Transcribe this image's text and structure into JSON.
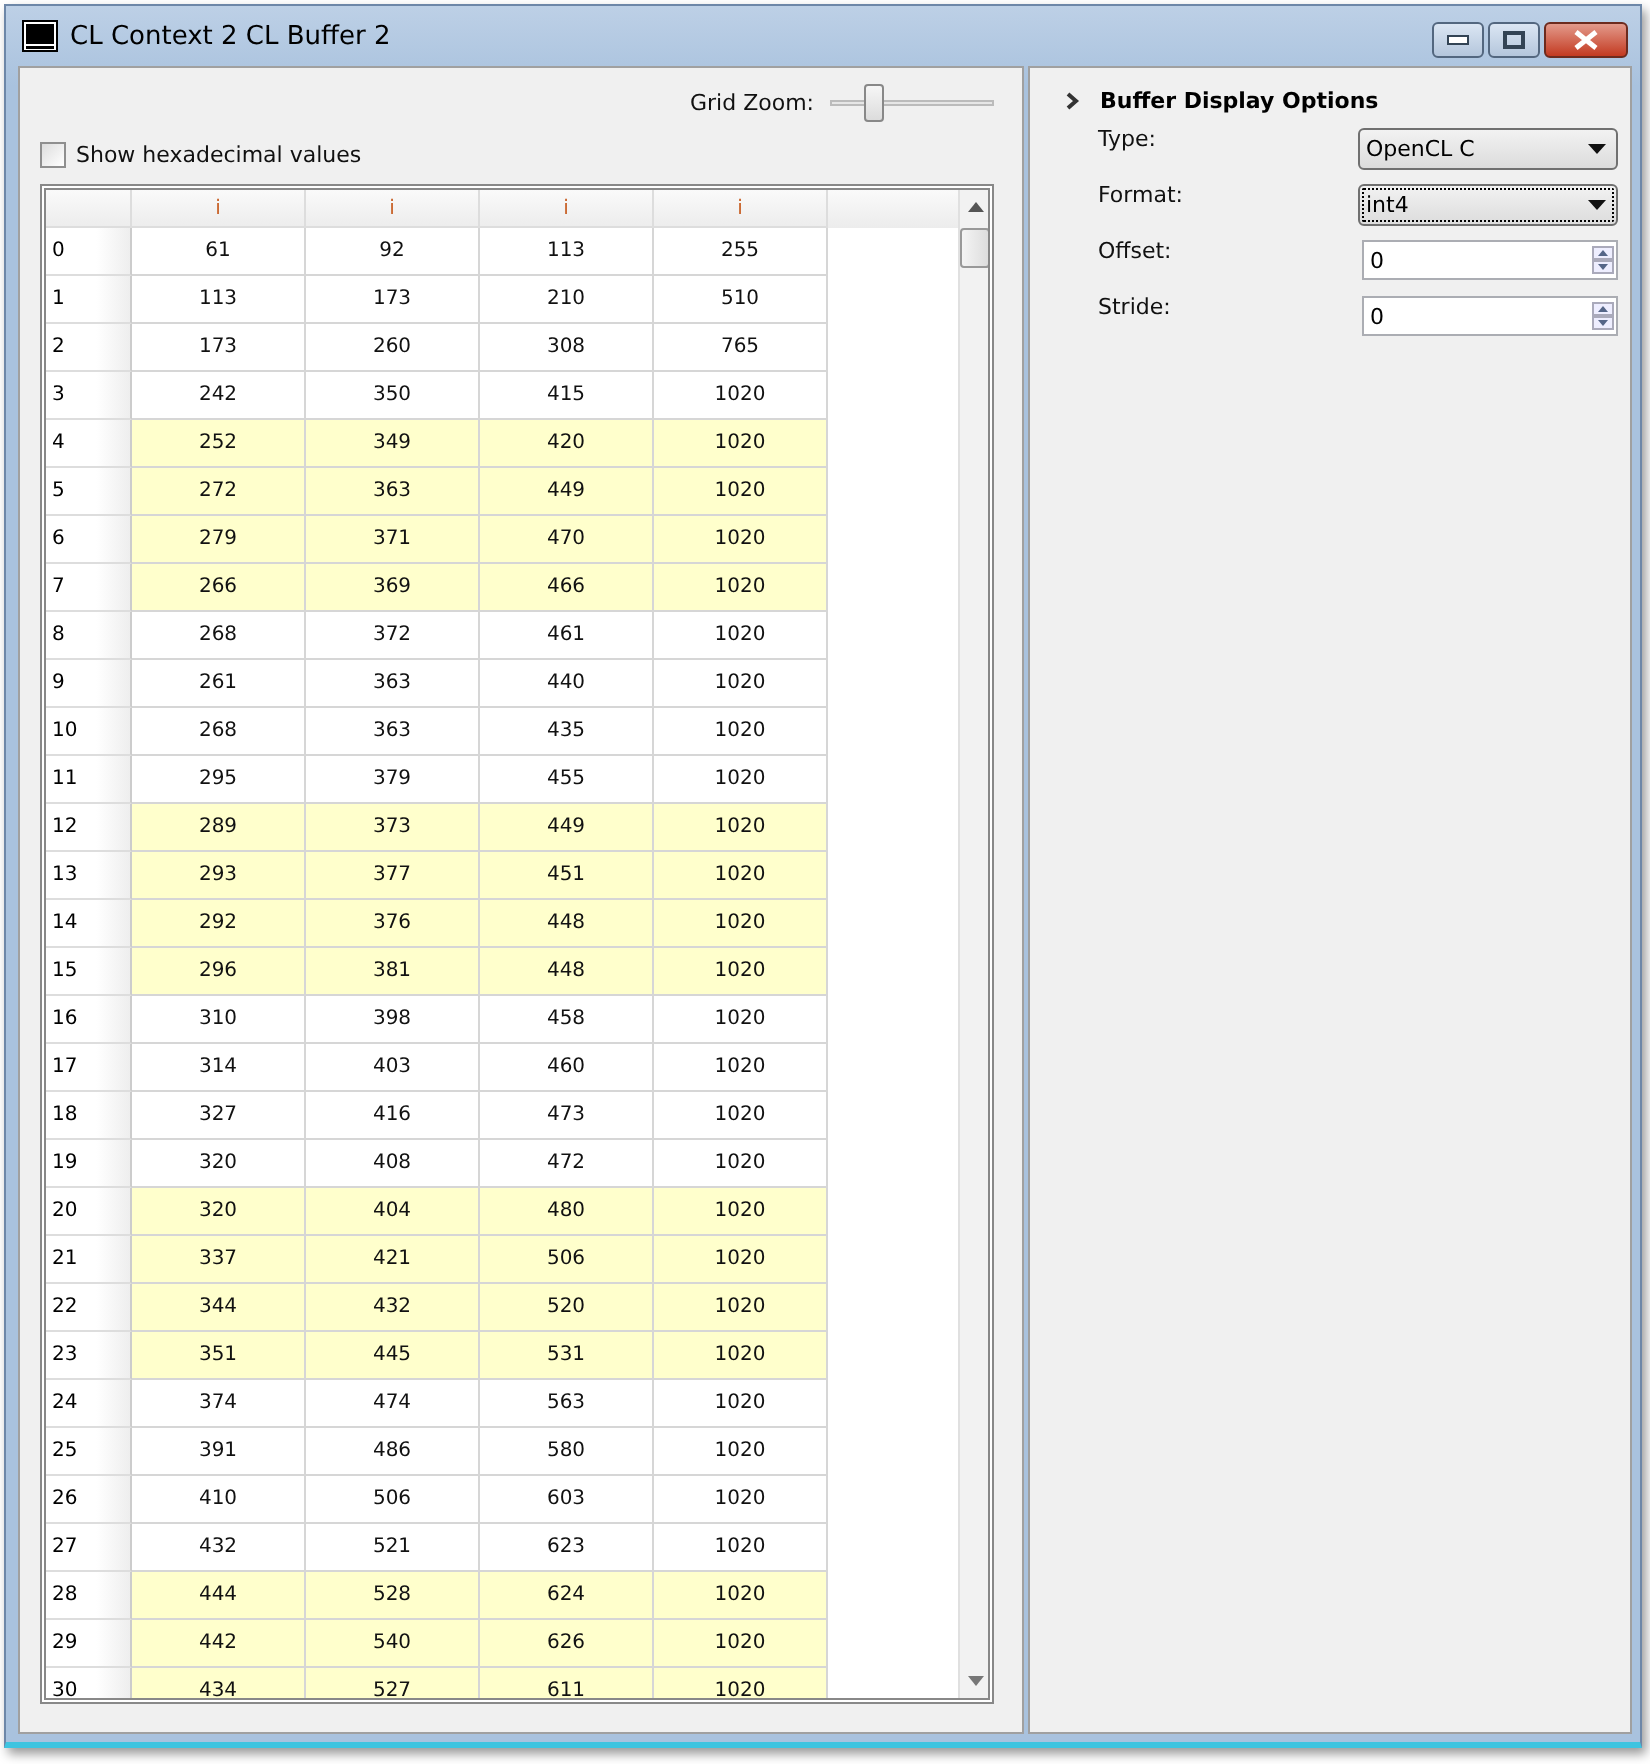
{
  "window": {
    "title": "CL Context 2 CL Buffer 2"
  },
  "grid_zoom": {
    "label": "Grid Zoom:",
    "level": 0.27
  },
  "show_hex": {
    "label": "Show hexadecimal values",
    "checked": false
  },
  "table": {
    "columns": [
      "i",
      "i",
      "i",
      "i"
    ],
    "rows": [
      {
        "index": "0",
        "values": [
          "61",
          "92",
          "113",
          "255"
        ],
        "highlighted": false
      },
      {
        "index": "1",
        "values": [
          "113",
          "173",
          "210",
          "510"
        ],
        "highlighted": false
      },
      {
        "index": "2",
        "values": [
          "173",
          "260",
          "308",
          "765"
        ],
        "highlighted": false
      },
      {
        "index": "3",
        "values": [
          "242",
          "350",
          "415",
          "1020"
        ],
        "highlighted": false
      },
      {
        "index": "4",
        "values": [
          "252",
          "349",
          "420",
          "1020"
        ],
        "highlighted": true
      },
      {
        "index": "5",
        "values": [
          "272",
          "363",
          "449",
          "1020"
        ],
        "highlighted": true
      },
      {
        "index": "6",
        "values": [
          "279",
          "371",
          "470",
          "1020"
        ],
        "highlighted": true
      },
      {
        "index": "7",
        "values": [
          "266",
          "369",
          "466",
          "1020"
        ],
        "highlighted": true
      },
      {
        "index": "8",
        "values": [
          "268",
          "372",
          "461",
          "1020"
        ],
        "highlighted": false
      },
      {
        "index": "9",
        "values": [
          "261",
          "363",
          "440",
          "1020"
        ],
        "highlighted": false
      },
      {
        "index": "10",
        "values": [
          "268",
          "363",
          "435",
          "1020"
        ],
        "highlighted": false
      },
      {
        "index": "11",
        "values": [
          "295",
          "379",
          "455",
          "1020"
        ],
        "highlighted": false
      },
      {
        "index": "12",
        "values": [
          "289",
          "373",
          "449",
          "1020"
        ],
        "highlighted": true
      },
      {
        "index": "13",
        "values": [
          "293",
          "377",
          "451",
          "1020"
        ],
        "highlighted": true
      },
      {
        "index": "14",
        "values": [
          "292",
          "376",
          "448",
          "1020"
        ],
        "highlighted": true
      },
      {
        "index": "15",
        "values": [
          "296",
          "381",
          "448",
          "1020"
        ],
        "highlighted": true
      },
      {
        "index": "16",
        "values": [
          "310",
          "398",
          "458",
          "1020"
        ],
        "highlighted": false
      },
      {
        "index": "17",
        "values": [
          "314",
          "403",
          "460",
          "1020"
        ],
        "highlighted": false
      },
      {
        "index": "18",
        "values": [
          "327",
          "416",
          "473",
          "1020"
        ],
        "highlighted": false
      },
      {
        "index": "19",
        "values": [
          "320",
          "408",
          "472",
          "1020"
        ],
        "highlighted": false
      },
      {
        "index": "20",
        "values": [
          "320",
          "404",
          "480",
          "1020"
        ],
        "highlighted": true
      },
      {
        "index": "21",
        "values": [
          "337",
          "421",
          "506",
          "1020"
        ],
        "highlighted": true
      },
      {
        "index": "22",
        "values": [
          "344",
          "432",
          "520",
          "1020"
        ],
        "highlighted": true
      },
      {
        "index": "23",
        "values": [
          "351",
          "445",
          "531",
          "1020"
        ],
        "highlighted": true
      },
      {
        "index": "24",
        "values": [
          "374",
          "474",
          "563",
          "1020"
        ],
        "highlighted": false
      },
      {
        "index": "25",
        "values": [
          "391",
          "486",
          "580",
          "1020"
        ],
        "highlighted": false
      },
      {
        "index": "26",
        "values": [
          "410",
          "506",
          "603",
          "1020"
        ],
        "highlighted": false
      },
      {
        "index": "27",
        "values": [
          "432",
          "521",
          "623",
          "1020"
        ],
        "highlighted": false
      },
      {
        "index": "28",
        "values": [
          "444",
          "528",
          "624",
          "1020"
        ],
        "highlighted": true
      },
      {
        "index": "29",
        "values": [
          "442",
          "540",
          "626",
          "1020"
        ],
        "highlighted": true
      },
      {
        "index": "30",
        "values": [
          "434",
          "527",
          "611",
          "1020"
        ],
        "highlighted": true
      }
    ]
  },
  "options": {
    "title": "Buffer Display Options",
    "expanded": true,
    "fields": [
      {
        "kind": "dropdown",
        "label": "Type:",
        "value": "OpenCL C",
        "focused": false
      },
      {
        "kind": "dropdown",
        "label": "Format:",
        "value": "int4",
        "focused": true
      },
      {
        "kind": "spinner",
        "label": "Offset:",
        "value": "0"
      },
      {
        "kind": "spinner",
        "label": "Stride:",
        "value": "0"
      }
    ]
  }
}
